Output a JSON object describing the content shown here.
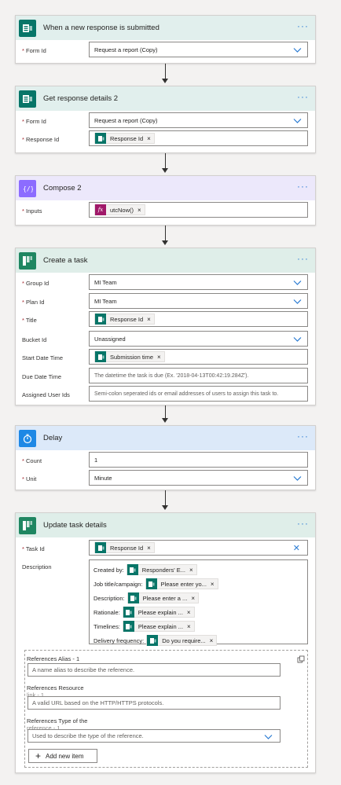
{
  "more_glyph": "···",
  "remove_glyph": "×",
  "clear_glyph": "✕",
  "cards": {
    "trigger": {
      "title": "When a new response is submitted",
      "form_id_label": "Form Id",
      "form_id_value": "Request a report (Copy)"
    },
    "get_details": {
      "title": "Get response details 2",
      "form_id_label": "Form Id",
      "form_id_value": "Request a report (Copy)",
      "response_id_label": "Response Id",
      "response_id_token": "Response Id"
    },
    "compose": {
      "title": "Compose 2",
      "inputs_label": "Inputs",
      "inputs_token": "utcNow()",
      "expr_icon": "fx"
    },
    "create_task": {
      "title": "Create a task",
      "group_id_label": "Group Id",
      "group_id_value": "MI Team",
      "plan_id_label": "Plan Id",
      "plan_id_value": "MI Team",
      "title_label": "Title",
      "title_token": "Response Id",
      "bucket_label": "Bucket Id",
      "bucket_value": "Unassigned",
      "start_label": "Start Date Time",
      "start_token": "Submission time",
      "due_label": "Due Date Time",
      "due_placeholder": "The datetime the task is due (Ex. '2018-04-13T00:42:19.284Z').",
      "assigned_label": "Assigned User Ids",
      "assigned_placeholder": "Semi-colon seperated ids or email addresses of users to assign this task to."
    },
    "delay": {
      "title": "Delay",
      "count_label": "Count",
      "count_value": "1",
      "unit_label": "Unit",
      "unit_value": "Minute"
    },
    "update_task": {
      "title": "Update task details",
      "task_id_label": "Task Id",
      "task_id_token": "Response Id",
      "description_label": "Description",
      "description_lines": [
        {
          "label": "Created by:",
          "token": "Responders' E..."
        },
        {
          "label": "Job title/campaign:",
          "token": "Please enter yo..."
        },
        {
          "label": "Description:",
          "token": "Please enter a ..."
        },
        {
          "label": "Rationale:",
          "token": "Please explain ..."
        },
        {
          "label": "Timelines:",
          "token": "Please explain ..."
        },
        {
          "label": "Delivery frequency:",
          "token": "Do you require..."
        }
      ],
      "references": {
        "alias_label": "References Alias - 1",
        "alias_placeholder": "A name alias to describe the reference.",
        "resource_label_1": "References Resource",
        "resource_label_2": "link - 1",
        "resource_placeholder": "A valid URL based on the HTTP/HTTPS protocols.",
        "type_label_1": "References Type of the",
        "type_label_2": "reference - 1",
        "type_placeholder": "Used to describe the type of the reference.",
        "add_button": "Add new item",
        "add_glyph": "+"
      }
    }
  },
  "colors": {
    "forms_teal": "#077568",
    "compose_purple": "#8c6cff",
    "planner_green": "#1f8661",
    "delay_blue": "#1e88e5",
    "link_blue": "#2b7cd3",
    "required_red": "#a4262c"
  },
  "icons": {
    "forms": "forms-icon",
    "compose": "compose-icon",
    "planner": "planner-icon",
    "delay": "timer-icon"
  }
}
